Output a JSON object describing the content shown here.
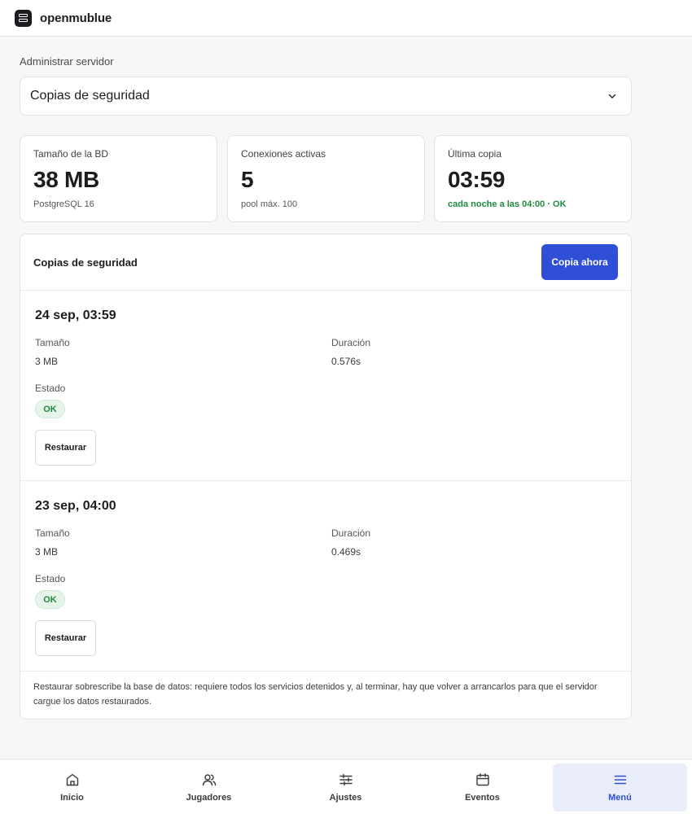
{
  "app": {
    "name": "openmublue"
  },
  "admin": {
    "label": "Administrar servidor",
    "selected": "Copias de seguridad"
  },
  "stats": [
    {
      "label": "Tamaño de la BD",
      "value": "38 MB",
      "sub": "PostgreSQL 16"
    },
    {
      "label": "Conexiones activas",
      "value": "5",
      "sub": "pool máx. 100"
    },
    {
      "label": "Última copia",
      "value": "03:59",
      "sub": "cada noche a las 04:00 · OK"
    }
  ],
  "backups": {
    "title": "Copias de seguridad",
    "action_label": "Copia ahora",
    "size_label": "Tamaño",
    "duration_label": "Duración",
    "status_label": "Estado",
    "restore_label": "Restaurar",
    "items": [
      {
        "date": "24 sep, 03:59",
        "size": "3 MB",
        "duration": "0.576s",
        "status": "OK"
      },
      {
        "date": "23 sep, 04:00",
        "size": "3 MB",
        "duration": "0.469s",
        "status": "OK"
      }
    ],
    "note": "Restaurar sobrescribe la base de datos: requiere todos los servicios detenidos y, al terminar, hay que volver a arrancarlos para que el servidor cargue los datos restaurados."
  },
  "nav": [
    {
      "label": "Inicio",
      "icon": "home-icon",
      "active": false
    },
    {
      "label": "Jugadores",
      "icon": "users-icon",
      "active": false
    },
    {
      "label": "Ajustes",
      "icon": "sliders-icon",
      "active": false
    },
    {
      "label": "Eventos",
      "icon": "calendar-icon",
      "active": false
    },
    {
      "label": "Menú",
      "icon": "menu-icon",
      "active": true
    }
  ],
  "colors": {
    "accent": "#2f4fd6",
    "ok": "#1f8a3f",
    "ok_bg": "#e6f4ea",
    "active_nav_bg": "#e9edf9"
  }
}
